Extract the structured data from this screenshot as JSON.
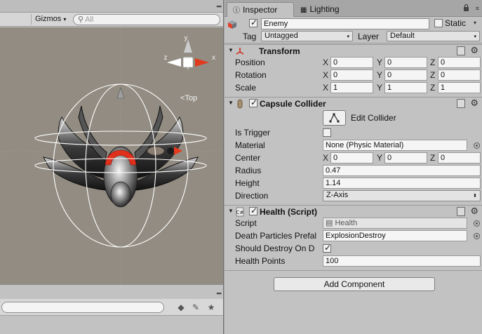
{
  "scene": {
    "gizmos_label": "Gizmos",
    "gizmos_arrow": "▾",
    "search_placeholder": "All",
    "view_label": "Top",
    "axis_labels": {
      "y": "y",
      "z": "z",
      "x": "x"
    }
  },
  "inspector": {
    "tab_inspector": "Inspector",
    "tab_lighting": "Lighting",
    "object": {
      "name": "Enemy",
      "active": true,
      "static_label": "Static",
      "static": false,
      "tag_label": "Tag",
      "tag_value": "Untagged",
      "layer_label": "Layer",
      "layer_value": "Default"
    },
    "transform": {
      "title": "Transform",
      "position": {
        "label": "Position",
        "x": "0",
        "y": "0",
        "z": "0"
      },
      "rotation": {
        "label": "Rotation",
        "x": "0",
        "y": "0",
        "z": "0"
      },
      "scale": {
        "label": "Scale",
        "x": "1",
        "y": "1",
        "z": "1"
      }
    },
    "capsule_collider": {
      "title": "Capsule Collider",
      "enabled": true,
      "edit_collider_label": "Edit Collider",
      "is_trigger_label": "Is Trigger",
      "is_trigger": false,
      "material_label": "Material",
      "material_value": "None (Physic Material)",
      "center_label": "Center",
      "center": {
        "x": "0",
        "y": "0",
        "z": "0"
      },
      "radius_label": "Radius",
      "radius_value": "0.47",
      "height_label": "Height",
      "height_value": "1.14",
      "direction_label": "Direction",
      "direction_value": "Z-Axis"
    },
    "health_script": {
      "title": "Health (Script)",
      "enabled": true,
      "script_label": "Script",
      "script_value": "Health",
      "death_particles_label": "Death Particles Prefal",
      "death_particles_value": "ExplosionDestroy",
      "should_destroy_label": "Should Destroy On D",
      "should_destroy": true,
      "health_points_label": "Health Points",
      "health_points_value": "100"
    },
    "add_component_label": "Add Component",
    "axis_x": "X",
    "axis_y": "Y",
    "axis_z": "Z"
  }
}
